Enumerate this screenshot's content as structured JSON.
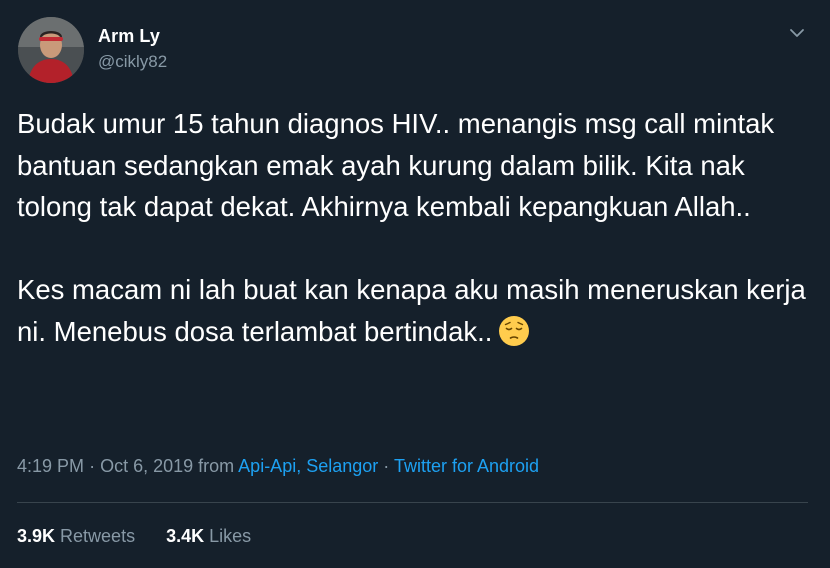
{
  "author": {
    "display_name": "Arm Ly",
    "handle": "@cikly82"
  },
  "tweet": {
    "paragraphs": [
      "Budak umur 15 tahun diagnos HIV.. menangis msg call mintak bantuan sedangkan emak ayah kurung dalam bilik. Kita nak tolong tak dapat dekat. Akhirnya kembali kepangkuan Allah..",
      "Kes macam ni lah buat kan kenapa aku masih meneruskan kerja ni. Menebus dosa terlambat bertindak.."
    ],
    "emoji": "pensive-face"
  },
  "meta": {
    "time": "4:19 PM",
    "separator": "·",
    "date": "Oct 6, 2019",
    "from_label": "from",
    "location": "Api-Api, Selangor",
    "source": "Twitter for Android"
  },
  "stats": {
    "retweets_count": "3.9K",
    "retweets_label": "Retweets",
    "likes_count": "3.4K",
    "likes_label": "Likes"
  },
  "colors": {
    "background": "#15202b",
    "text_primary": "#ffffff",
    "text_secondary": "#8899a6",
    "link": "#1da1f2",
    "divider": "#38444d"
  },
  "icons": {
    "caret": "chevron-down-icon",
    "avatar": "avatar"
  }
}
